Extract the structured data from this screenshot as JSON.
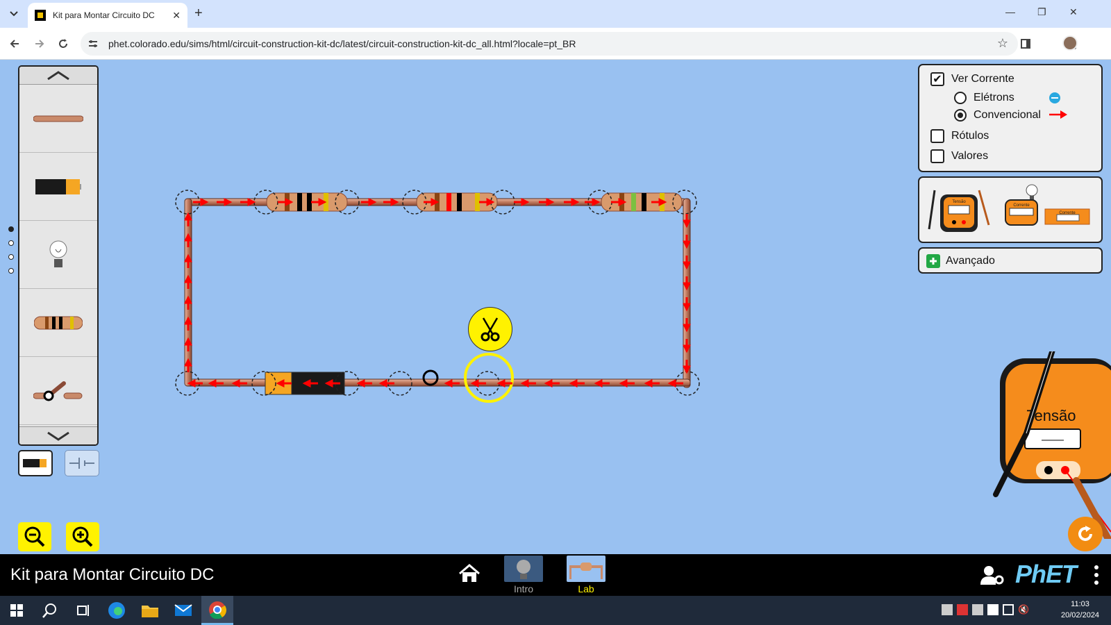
{
  "browser": {
    "tab_title": "Kit para Montar Circuito DC",
    "new_tab": "+",
    "close": "✕",
    "minimize": "—",
    "restore": "❐",
    "close_window": "✕",
    "url": "phet.colorado.edu/sims/html/circuit-construction-kit-dc/latest/circuit-construction-kit-dc_all.html?locale=pt_BR"
  },
  "toolbox": {
    "items": [
      "wire",
      "battery",
      "light-bulb",
      "resistor",
      "switch"
    ],
    "page_dots": 4,
    "active_page": 0
  },
  "panel": {
    "show_current": "Ver Corrente",
    "show_current_checked": true,
    "electrons": "Elétrons",
    "conventional": "Convencional",
    "conventional_selected": true,
    "labels": "Rótulos",
    "labels_checked": false,
    "values": "Valores",
    "values_checked": false,
    "advanced": "Avançado"
  },
  "sensors": {
    "voltmeter_label": "Tensão",
    "ammeter_label": "Corrente"
  },
  "meter": {
    "label": "Tensão",
    "reading": "——"
  },
  "navbar": {
    "title": "Kit para Montar Circuito DC",
    "screens": [
      "Intro",
      "Lab"
    ],
    "active_screen": "Lab",
    "logo": "PhET"
  },
  "taskbar": {
    "time": "11:03",
    "date": "20/02/2024"
  },
  "colors": {
    "sim_bg": "#99c1f1",
    "wire": "#c98a6a",
    "current_arrow": "#ff0000",
    "highlight": "#fff200",
    "phet_blue": "#6fcbf4",
    "lab_active": "#fff200"
  }
}
